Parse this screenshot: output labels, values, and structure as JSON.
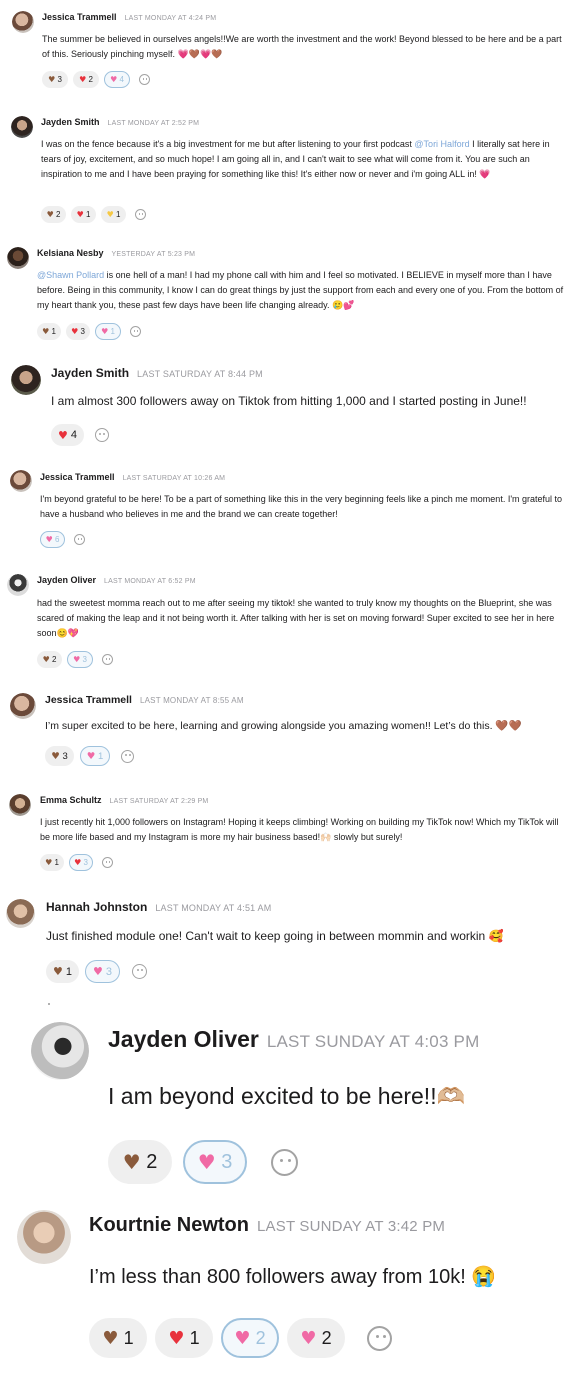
{
  "messages": [
    {
      "author": "Jessica Trammell",
      "time": "LAST MONDAY AT 4:24 PM",
      "text": "The summer be believed in ourselves angels!!We are worth the investment and the work! Beyond blessed to be here and be a part of this. Seriously pinching myself. 💗🤎💗🤎",
      "reactions": [
        {
          "emoji": "brown-heart",
          "count": "3",
          "active": false
        },
        {
          "emoji": "red-heart",
          "count": "2",
          "active": false
        },
        {
          "emoji": "sparkling-heart",
          "count": "4",
          "active": true
        }
      ]
    },
    {
      "author": "Jayden Smith",
      "time": "LAST MONDAY AT 2:52 PM",
      "text_before": "I was on the fence because it's a big investment for me but after listening to your first podcast ",
      "mention": "@Tori Halford",
      "text_after": " I literally sat here in tears of joy, excitement, and so much hope! I am going all in, and I can't wait to see what will come from it. You are such an inspiration to me and I have been praying for something like this! It's either now or never and i'm going ALL in! 💗",
      "reactions": [
        {
          "emoji": "brown-heart",
          "count": "2",
          "active": false
        },
        {
          "emoji": "red-heart",
          "count": "1",
          "active": false
        },
        {
          "emoji": "yellow-heart",
          "count": "1",
          "active": false
        }
      ]
    },
    {
      "author": "Kelsiana Nesby",
      "time": "YESTERDAY AT 5:23 PM",
      "mention": "@Shawn Pollard",
      "text_after": " is one hell of a man! I had my phone call with him and I feel so motivated. I BELIEVE in myself more than I have before. Being in this community, I know I can do great things by just the support from each and every one of you. From the bottom of my heart thank you, these past few days have been life changing already. 🥲💕",
      "reactions": [
        {
          "emoji": "brown-heart",
          "count": "1",
          "active": false
        },
        {
          "emoji": "red-heart",
          "count": "3",
          "active": false
        },
        {
          "emoji": "sparkling-heart",
          "count": "1",
          "active": true
        }
      ]
    },
    {
      "author": "Jayden Smith",
      "time": "LAST SATURDAY AT 8:44 PM",
      "text": "I am almost 300 followers away on Tiktok from hitting 1,000 and I started posting in June!!",
      "reactions": [
        {
          "emoji": "red-heart",
          "count": "4",
          "active": false
        }
      ]
    },
    {
      "author": "Jessica Trammell",
      "time": "LAST SATURDAY AT 10:26 AM",
      "text": "I'm beyond grateful to be here! To be a part of something like this in the very beginning feels like a pinch me moment. I'm grateful to have a husband who believes in me and the brand we can create together!",
      "reactions": [
        {
          "emoji": "two-hearts",
          "count": "6",
          "active": true
        }
      ]
    },
    {
      "author": "Jayden Oliver",
      "time": "LAST MONDAY AT 6:52 PM",
      "text": "had the sweetest momma reach out to me after seeing my tiktok! she wanted to truly know my thoughts on the Blueprint, she was scared of making the leap and it not being worth it. After talking with her is set on moving forward! Super excited to see her in here soon😊💖",
      "reactions": [
        {
          "emoji": "brown-heart",
          "count": "2",
          "active": false
        },
        {
          "emoji": "sparkling-heart",
          "count": "3",
          "active": true
        }
      ]
    },
    {
      "author": "Jessica Trammell",
      "time": "LAST MONDAY AT 8:55 AM",
      "text": "I’m super excited to be here, learning and growing alongside you amazing women!! Let’s do this. 🤎🤎",
      "reactions": [
        {
          "emoji": "brown-heart",
          "count": "3",
          "active": false
        },
        {
          "emoji": "sparkling-heart",
          "count": "1",
          "active": true
        }
      ]
    },
    {
      "author": "Emma Schultz",
      "time": "LAST SATURDAY AT 2:29 PM",
      "text": "I just recently hit 1,000 followers on Instagram! Hoping it keeps climbing! Working on building my TikTok now! Which my TikTok will be more life based and my Instagram is more my hair business based!🙌🏻 slowly but surely!",
      "reactions": [
        {
          "emoji": "brown-heart",
          "count": "1",
          "active": false
        },
        {
          "emoji": "red-heart",
          "count": "3",
          "active": true
        }
      ]
    },
    {
      "author": "Hannah Johnston",
      "time": "LAST MONDAY AT 4:51 AM",
      "text": "Just finished module one! Can't wait to keep going in between mommin and workin 🥰",
      "reactions": [
        {
          "emoji": "brown-heart",
          "count": "1",
          "active": false
        },
        {
          "emoji": "sparkling-heart",
          "count": "3",
          "active": true
        }
      ]
    },
    {
      "author": "Jayden Oliver",
      "time": "LAST SUNDAY AT 4:03 PM",
      "text": "I am beyond excited to be here!!🫶🏼",
      "reactions": [
        {
          "emoji": "brown-heart",
          "count": "2",
          "active": false
        },
        {
          "emoji": "sparkling-heart",
          "count": "3",
          "active": true
        }
      ]
    },
    {
      "author": "Kourtnie Newton",
      "time": "LAST SUNDAY AT 3:42 PM",
      "text": "I’m less than 800 followers away from 10k! 😭",
      "reactions": [
        {
          "emoji": "brown-heart",
          "count": "1",
          "active": false
        },
        {
          "emoji": "red-heart",
          "count": "1",
          "active": false
        },
        {
          "emoji": "sparkling-heart",
          "count": "2",
          "active": true
        },
        {
          "emoji": "two-hearts",
          "count": "2",
          "active": false
        }
      ]
    }
  ],
  "colors": {
    "mention": "#7ea7d8",
    "active_border": "#9fc2dd",
    "pill_bg": "#efefef",
    "timestamp": "#9a9a9f"
  },
  "icons": [
    "add-reaction-icon"
  ]
}
